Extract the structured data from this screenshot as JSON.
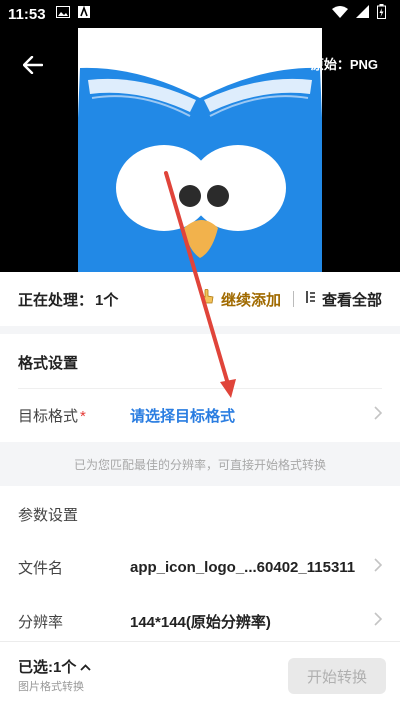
{
  "status_bar": {
    "time": "11:53"
  },
  "preview": {
    "original_label": "原始：PNG"
  },
  "processing": {
    "label": "正在处理：",
    "count": "1个",
    "continue_add": "继续添加",
    "view_all": "查看全部"
  },
  "format_settings": {
    "title": "格式设置",
    "target_label": "目标格式",
    "required_mark": "*",
    "target_value": "请选择目标格式",
    "hint": "已为您匹配最佳的分辨率，可直接开始格式转换"
  },
  "params": {
    "title": "参数设置",
    "filename_label": "文件名",
    "filename_value": "app_icon_logo_...60402_115311",
    "resolution_label": "分辨率",
    "resolution_value": "144*144(原始分辨率)"
  },
  "bottom": {
    "selected": "已选:1个",
    "caption": "图片格式转换",
    "start_button": "开始转换"
  },
  "colors": {
    "accent_blue": "#2a7de1",
    "continue_gold": "#a06a00",
    "annotation_red": "#e0443a",
    "logo_blue": "#2289e6"
  }
}
